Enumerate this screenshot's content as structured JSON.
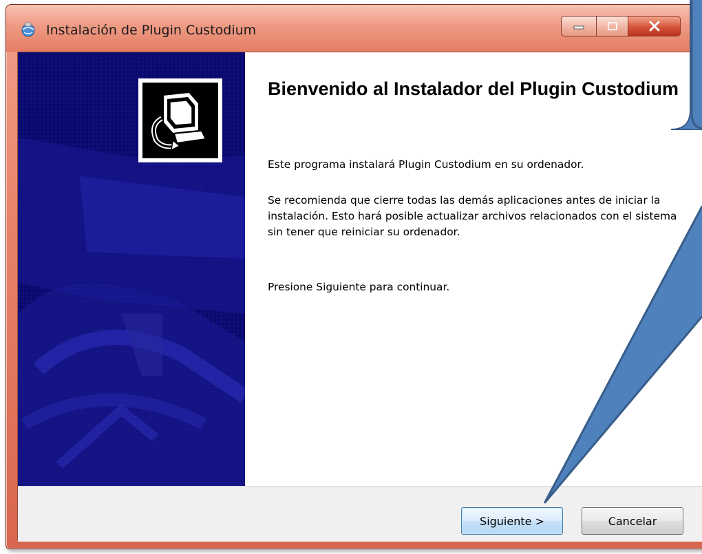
{
  "window": {
    "title": "Instalación de Plugin Custodium"
  },
  "caption_buttons": {
    "minimize_icon": "minimize-icon",
    "maximize_icon": "maximize-icon",
    "close_icon": "close-icon"
  },
  "content": {
    "heading": "Bienvenido al Instalador del Plugin Custodium",
    "paragraph1": "Este programa instalará Plugin Custodium en su ordenador.",
    "paragraph2": "Se recomienda que cierre todas las demás aplicaciones antes de iniciar la instalación. Esto hará posible actualizar archivos relacionados con el sistema sin tener que reiniciar su ordenador.",
    "paragraph3": "Presione Siguiente para continuar."
  },
  "buttons": {
    "next_label": "Siguiente >",
    "cancel_label": "Cancelar"
  },
  "colors": {
    "side_panel": "#0a0a6e",
    "callout_fill": "#4f81bd",
    "callout_stroke": "#385d8a",
    "titlebar_accent": "#e47d65"
  },
  "icons": {
    "app_icon": "installer-globe-icon",
    "logo": "installer-computer-logo"
  }
}
